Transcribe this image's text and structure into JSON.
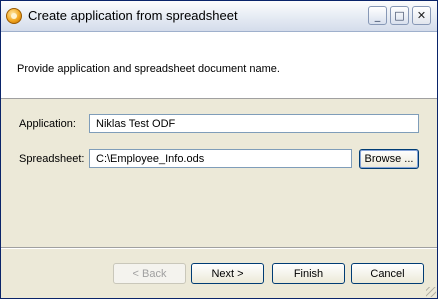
{
  "window": {
    "title": "Create application from spreadsheet",
    "controls": {
      "minimize": "_",
      "maximize": "□",
      "close": "✕"
    }
  },
  "header": {
    "message": "Provide application and spreadsheet document name."
  },
  "form": {
    "application_label": "Application:",
    "application_value": "Niklas Test ODF",
    "spreadsheet_label": "Spreadsheet:",
    "spreadsheet_value": "C:\\Employee_Info.ods",
    "browse_label": "Browse ..."
  },
  "footer": {
    "back_label": "< Back",
    "next_label": "Next >",
    "finish_label": "Finish",
    "cancel_label": "Cancel"
  }
}
